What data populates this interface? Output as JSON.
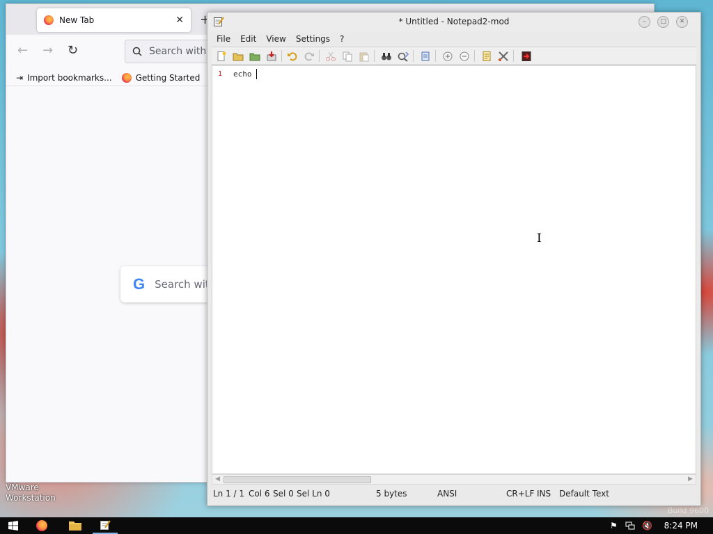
{
  "desktop": {
    "vmware_label": "VMware\nWorkstation",
    "build_label": "Build 9600"
  },
  "firefox": {
    "tab_title": "New Tab",
    "tab_close": "✕",
    "new_tab": "+",
    "url_placeholder": "Search with G",
    "bookmarks": [
      "Import bookmarks...",
      "Getting Started"
    ],
    "google_search_placeholder": "Search with"
  },
  "notepad": {
    "title": "* Untitled - Notepad2-mod",
    "menu": [
      "File",
      "Edit",
      "View",
      "Settings",
      "?"
    ],
    "toolbar_icons": [
      "new-file-icon",
      "open-file-icon",
      "browse-icon",
      "save-icon",
      "undo-icon",
      "redo-icon",
      "cut-icon",
      "copy-icon",
      "paste-icon",
      "find-icon",
      "replace-icon",
      "word-wrap-icon",
      "zoom-in-icon",
      "zoom-out-icon",
      "scheme-icon",
      "customize-icon",
      "exit-icon"
    ],
    "editor": {
      "line_number": "1",
      "content": "echo "
    },
    "status": {
      "line": "Ln 1 / 1",
      "col": "Col 6",
      "sel": "Sel 0",
      "sel_ln": "Sel Ln 0",
      "size": "5 bytes",
      "encoding": "ANSI",
      "eol": "CR+LF",
      "mode": "INS",
      "scheme": "Default Text"
    }
  },
  "taskbar": {
    "clock": "8:24 PM",
    "apps": [
      "start-icon",
      "firefox-icon",
      "file-explorer-icon",
      "notepad2-icon"
    ],
    "tray": [
      "flag-icon",
      "network-icon",
      "volume-muted-icon"
    ]
  },
  "colors": {
    "line_number": "#c01818",
    "taskbar": "#0b0b0b",
    "wallpaper_blue": "#5fb6d2"
  }
}
